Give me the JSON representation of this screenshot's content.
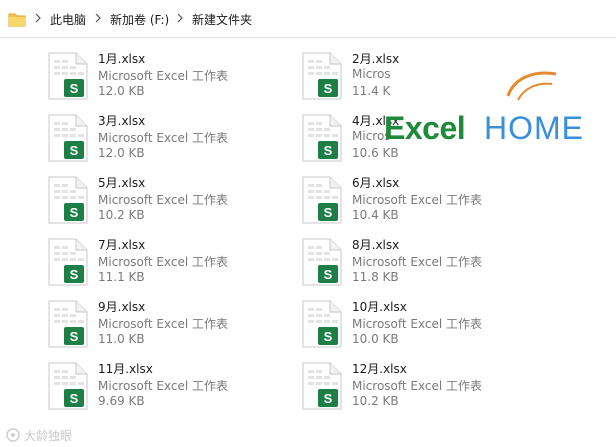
{
  "breadcrumb": {
    "items": [
      "此电脑",
      "新加卷 (F:)",
      "新建文件夹"
    ]
  },
  "files": [
    {
      "name": "1月.xlsx",
      "type": "Microsoft Excel 工作表",
      "size": "12.0 KB"
    },
    {
      "name": "2月.xlsx",
      "type": "Micros",
      "size": "11.4 K"
    },
    {
      "name": "3月.xlsx",
      "type": "Microsoft Excel 工作表",
      "size": "12.0 KB"
    },
    {
      "name": "4月.xlsx",
      "type": "Micros",
      "size": "10.6 KB"
    },
    {
      "name": "5月.xlsx",
      "type": "Microsoft Excel 工作表",
      "size": "10.2 KB"
    },
    {
      "name": "6月.xlsx",
      "type": "Microsoft Excel 工作表",
      "size": "10.4 KB"
    },
    {
      "name": "7月.xlsx",
      "type": "Microsoft Excel 工作表",
      "size": "11.1 KB"
    },
    {
      "name": "8月.xlsx",
      "type": "Microsoft Excel 工作表",
      "size": "11.8 KB"
    },
    {
      "name": "9月.xlsx",
      "type": "Microsoft Excel 工作表",
      "size": "11.0 KB"
    },
    {
      "name": "10月.xlsx",
      "type": "Microsoft Excel 工作表",
      "size": "10.0 KB"
    },
    {
      "name": "11月.xlsx",
      "type": "Microsoft Excel 工作表",
      "size": "9.69 KB"
    },
    {
      "name": "12月.xlsx",
      "type": "Microsoft Excel 工作表",
      "size": "10.2 KB"
    }
  ],
  "file_icon": {
    "letter": "S",
    "name": "spreadsheet-file-icon"
  },
  "logo": {
    "excel": "Excel",
    "home": "HOME"
  },
  "watermark": {
    "text": "大龄独眼"
  },
  "colors": {
    "excel_green": "#1d7f46",
    "icon_grid": "#e3e3e3",
    "logo_green": "#1f8a3a",
    "logo_blue": "#3a8fd6",
    "logo_orange": "#e68a2e",
    "folder_yellow": "#f3c54a"
  }
}
